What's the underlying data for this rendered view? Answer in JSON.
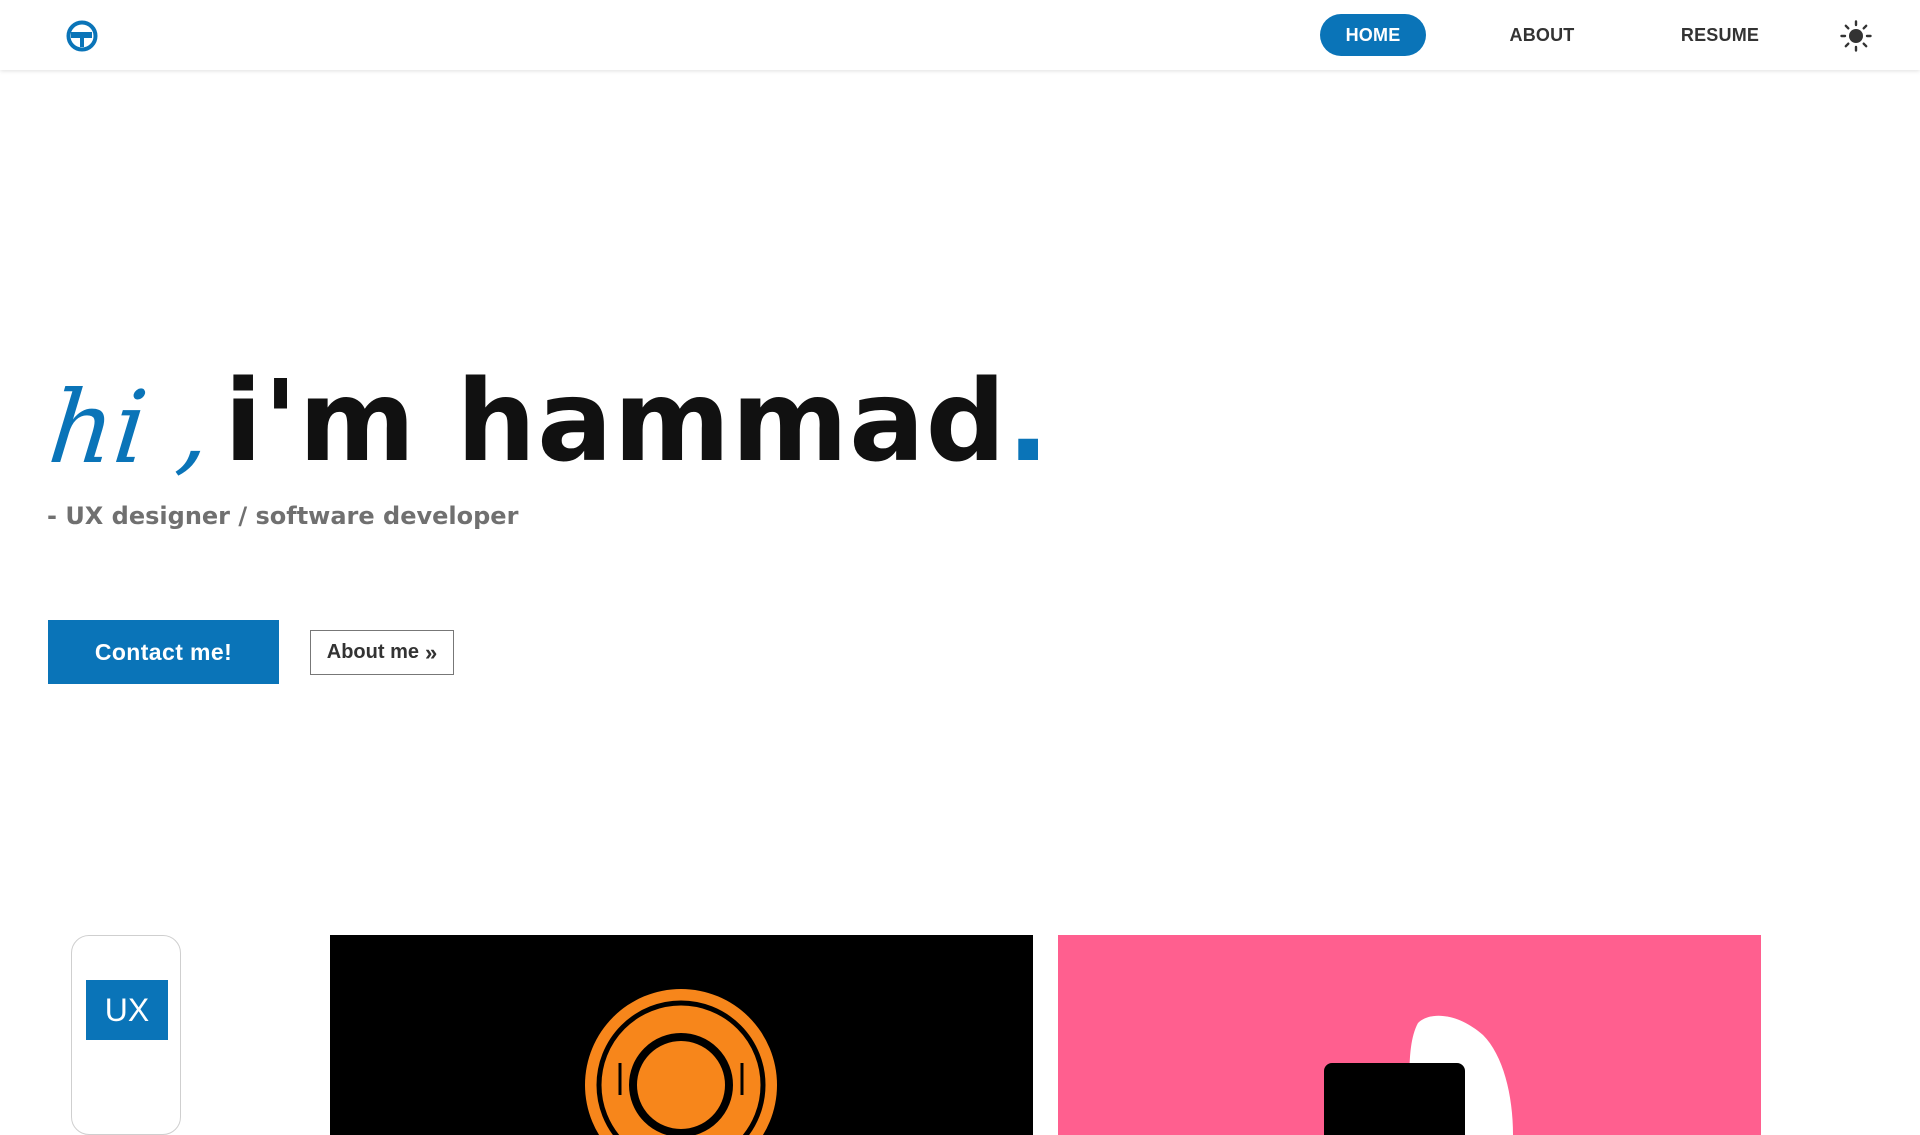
{
  "nav": {
    "logo_icon": "logo-icon",
    "items": [
      {
        "label": "HOME",
        "active": true
      },
      {
        "label": "ABOUT",
        "active": false
      },
      {
        "label": "RESUME",
        "active": false
      }
    ],
    "theme_icon": "sun-icon"
  },
  "hero": {
    "greeting": "hi ,",
    "name": "i'm hammad",
    "name_punctuation": ".",
    "subtitle": "- UX designer / software developer",
    "contact_label": "Contact me!",
    "about_label": "About me",
    "about_icon": "double-chevron-right-icon"
  },
  "work": {
    "filters": [
      {
        "label": "UX",
        "selected": true
      }
    ],
    "projects": [
      {
        "thumb_background": "#000000",
        "thumb_icon": "orange-circle-logo"
      },
      {
        "thumb_background": "#ff5f8f",
        "thumb_icon": "white-shape-logo"
      }
    ]
  },
  "colors": {
    "accent": "#0a74b8",
    "text_dark": "#111111",
    "text_muted": "#707070",
    "card_black": "#000000",
    "card_pink": "#ff5f8f",
    "orange": "#f7861b"
  }
}
